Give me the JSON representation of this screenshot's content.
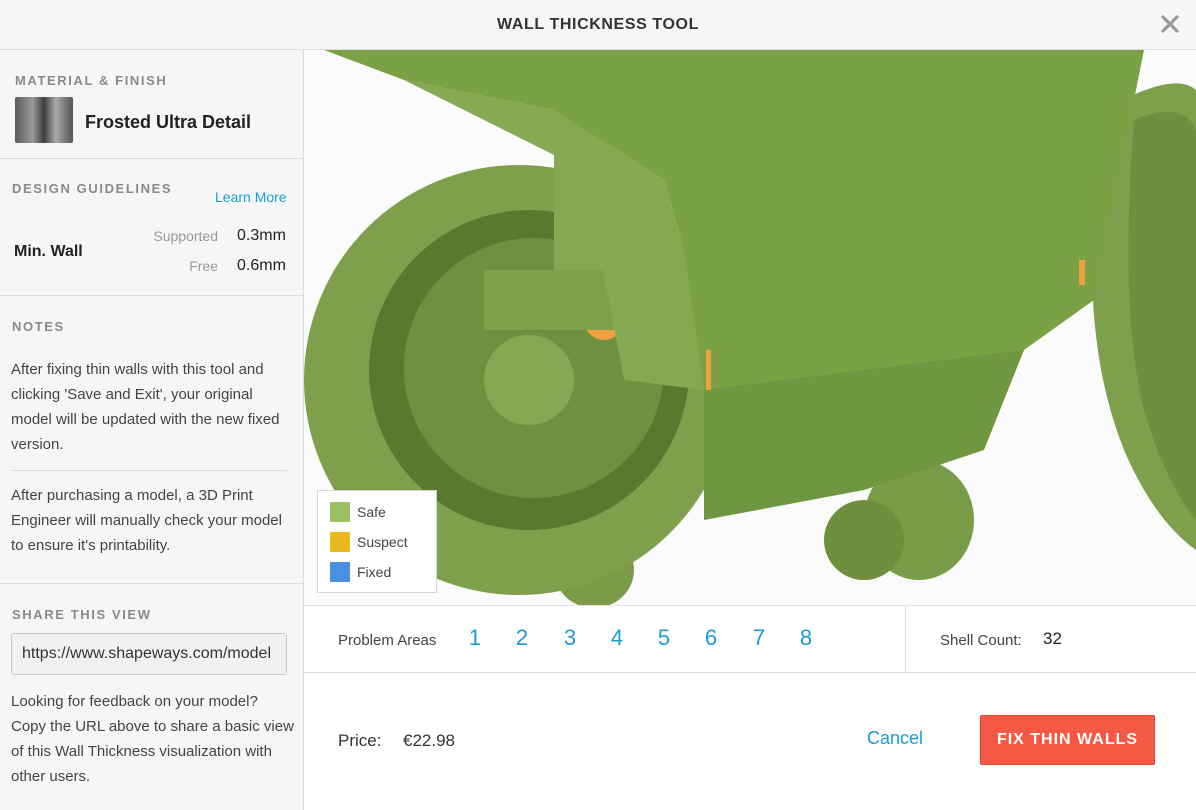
{
  "header": {
    "title": "WALL THICKNESS TOOL"
  },
  "material": {
    "section_title": "MATERIAL & FINISH",
    "name": "Frosted Ultra Detail"
  },
  "guidelines": {
    "section_title": "DESIGN GUIDELINES",
    "learn_more": "Learn More",
    "label": "Min. Wall",
    "supported_label": "Supported",
    "supported_value": "0.3mm",
    "free_label": "Free",
    "free_value": "0.6mm"
  },
  "notes": {
    "section_title": "NOTES",
    "paragraphs": [
      "After fixing thin walls with this tool and clicking 'Save and Exit', your original model will be updated with the new fixed version.",
      "After purchasing a model, a 3D Print Engineer will manually check your model to ensure it's printability."
    ]
  },
  "share": {
    "section_title": "SHARE THIS VIEW",
    "url_value": "https://www.shapeways.com/model",
    "note": "Looking for feedback on your model? Copy the URL above to share a basic view of this Wall Thickness visualization with other users."
  },
  "legend": {
    "items": [
      {
        "label": "Safe",
        "color": "#9bbf63"
      },
      {
        "label": "Suspect",
        "color": "#e6b922"
      },
      {
        "label": "Fixed",
        "color": "#4a90e2"
      }
    ]
  },
  "problem_areas": {
    "label": "Problem Areas",
    "items": [
      "1",
      "2",
      "3",
      "4",
      "5",
      "6",
      "7",
      "8"
    ]
  },
  "shell": {
    "label": "Shell Count:",
    "value": "32"
  },
  "footer": {
    "price_label": "Price:",
    "price_value": "€22.98",
    "cancel_label": "Cancel",
    "fix_label": "FIX THIN WALLS"
  },
  "colors": {
    "accent_blue": "#1a9bd7",
    "button_red": "#f55845",
    "model_green": "#7ea04c",
    "problem_orange": "#f0a040"
  }
}
